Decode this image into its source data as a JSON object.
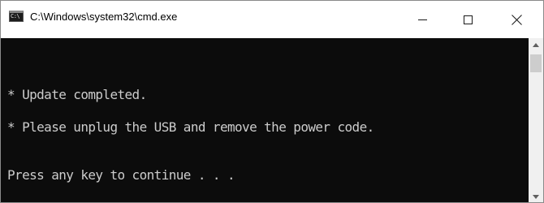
{
  "window": {
    "title": "C:\\Windows\\system32\\cmd.exe",
    "icon": "cmd-icon",
    "icon_glyph": "C:\\"
  },
  "console": {
    "lines": [
      "* Update completed.",
      "* Please unplug the USB and remove the power code.",
      "Press any key to continue . . ."
    ],
    "background": "#0c0c0c",
    "foreground": "#cccccc"
  },
  "controls": {
    "minimize_icon": "minimize-icon",
    "maximize_icon": "maximize-icon",
    "close_icon": "close-icon"
  },
  "scrollbar": {
    "up_icon": "scroll-up-arrow-icon",
    "down_icon": "scroll-down-arrow-icon"
  }
}
